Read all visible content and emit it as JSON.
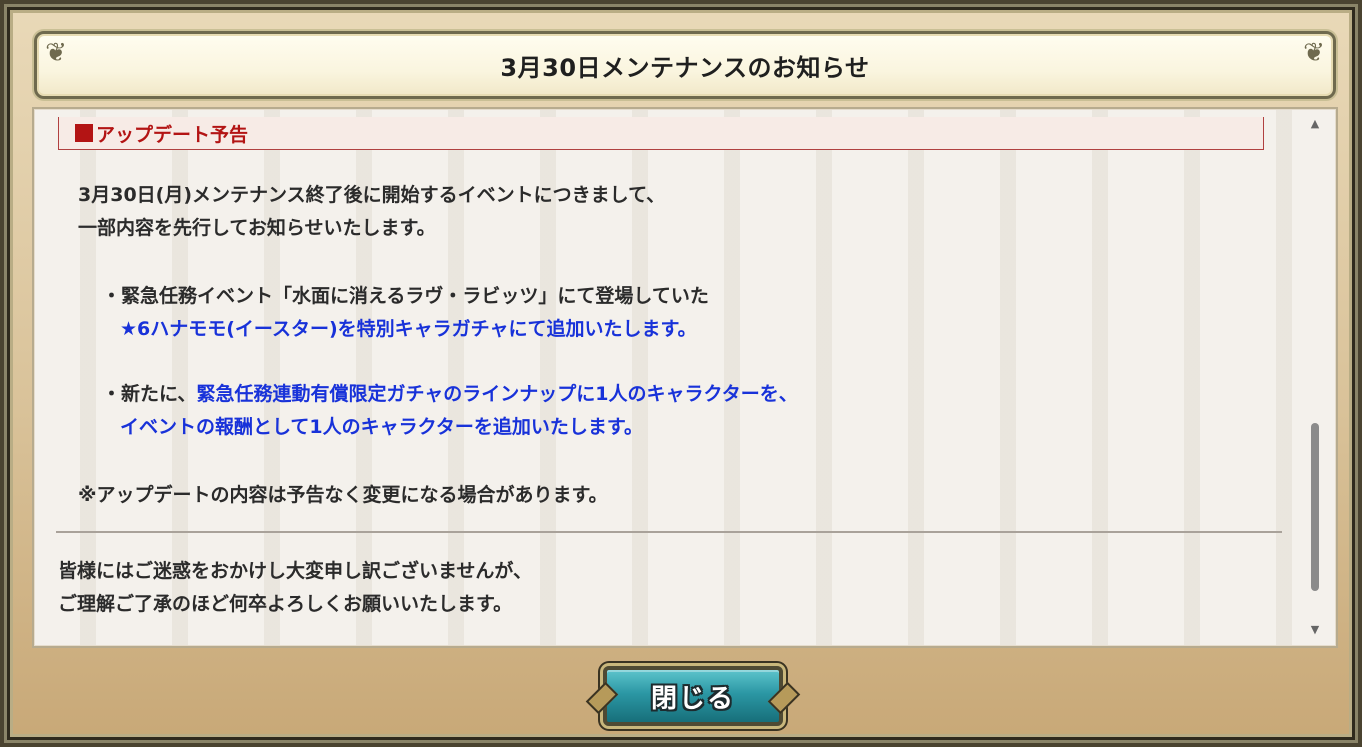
{
  "dialog": {
    "title": "3月30日メンテナンスのお知らせ",
    "section_header": "アップデート予告",
    "intro_line1": "3月30日(月)メンテナンス終了後に開始するイベントにつきまして、",
    "intro_line2": "一部内容を先行してお知らせいたします。",
    "bullet1_line1": "・緊急任務イベント「水面に消えるラヴ・ラビッツ」にて登場していた",
    "bullet1_line2": "★6ハナモモ(イースター)を特別キャラガチャにて追加いたします。",
    "bullet2_prefix": "・新たに、",
    "bullet2_line1_blue": "緊急任務連動有償限定ガチャのラインナップに1人のキャラクターを、",
    "bullet2_line2": "イベントの報酬として1人のキャラクターを追加いたします。",
    "notice": "※アップデートの内容は予告なく変更になる場合があります。",
    "closing_line1": "皆様にはご迷惑をおかけし大変申し訳ございませんが、",
    "closing_line2": "ご理解ご了承のほど何卒よろしくお願いいたします。",
    "close_button": "閉じる"
  },
  "icons": {
    "scroll_up": "triangle-up-icon",
    "scroll_down": "triangle-down-icon",
    "section_marker": "red-square-icon"
  },
  "colors": {
    "section_red": "#b31414",
    "highlight_blue": "#1832d9",
    "button_teal": "#2b97a4"
  }
}
